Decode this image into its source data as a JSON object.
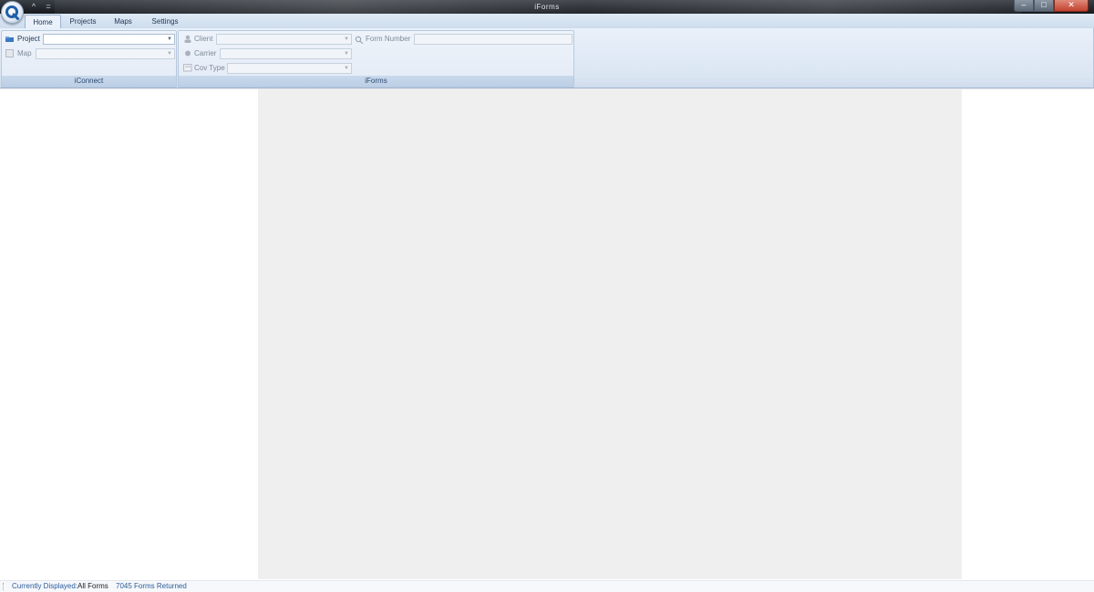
{
  "window": {
    "title": "iForms"
  },
  "titlebar": {
    "qat": [
      "^",
      "="
    ],
    "buttons": [
      "–",
      "□",
      "✕"
    ]
  },
  "tabs": [
    {
      "label": "Home",
      "active": true
    },
    {
      "label": "Projects",
      "active": false
    },
    {
      "label": "Maps",
      "active": false
    },
    {
      "label": "Settings",
      "active": false
    }
  ],
  "iconnect": {
    "group_label": "iConnect",
    "project_label": "Project",
    "project_value": "",
    "map_label": "Map",
    "map_value": ""
  },
  "iforms": {
    "group_label": "iForms",
    "client_label": "Client",
    "carrier_label": "Carrier",
    "cov_type_label": "Cov Type",
    "form_number_label": "Form Number",
    "form_number_value": ""
  },
  "statusbar": {
    "currently_displayed_label": "Currently Displayed:",
    "currently_displayed_value": "All Forms",
    "forms_returned": "7045 Forms Returned"
  },
  "colors": {
    "accent": "#2b4a70",
    "ribbon": "#dbe6f3",
    "panel": "#efefef",
    "status_text": "#2c5c9a"
  }
}
